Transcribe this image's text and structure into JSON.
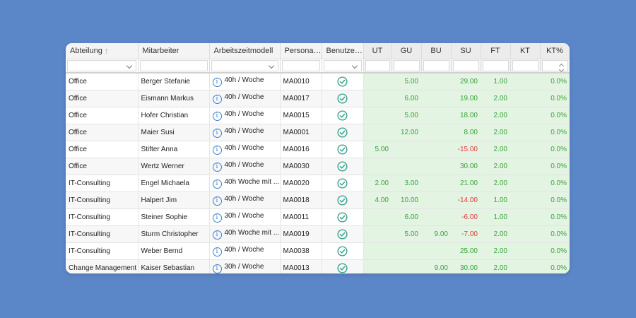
{
  "columns": [
    {
      "label": "Abteilung",
      "sort": "asc"
    },
    {
      "label": "Mitarbeiter"
    },
    {
      "label": "Arbeitszeitmodell"
    },
    {
      "label": "Personal..."
    },
    {
      "label": "Benutzer..."
    },
    {
      "label": "UT"
    },
    {
      "label": "GU"
    },
    {
      "label": "BU"
    },
    {
      "label": "SU"
    },
    {
      "label": "FT"
    },
    {
      "label": "KT"
    },
    {
      "label": "KT%"
    }
  ],
  "colors": {
    "background": "#5b87c9",
    "positive": "#3aa33a",
    "negative": "#e03a3a",
    "numeric_bg": "#e3f4e3",
    "check": "#2e9e8a",
    "info": "#3a7fd0"
  },
  "rows": [
    {
      "abteilung": "Office",
      "mitarbeiter": "Berger Stefanie",
      "modell": "40h / Woche",
      "personal": "MA0010",
      "ut": "",
      "gu": "5.00",
      "bu": "",
      "su": "29.00",
      "ft": "1.00",
      "kt": "",
      "ktp": "0.0%"
    },
    {
      "abteilung": "Office",
      "mitarbeiter": "Eismann Markus",
      "modell": "40h / Woche",
      "personal": "MA0017",
      "ut": "",
      "gu": "6.00",
      "bu": "",
      "su": "19.00",
      "ft": "2.00",
      "kt": "",
      "ktp": "0.0%"
    },
    {
      "abteilung": "Office",
      "mitarbeiter": "Hofer Christian",
      "modell": "40h / Woche",
      "personal": "MA0015",
      "ut": "",
      "gu": "5.00",
      "bu": "",
      "su": "18.00",
      "ft": "2.00",
      "kt": "",
      "ktp": "0.0%"
    },
    {
      "abteilung": "Office",
      "mitarbeiter": "Maier Susi",
      "modell": "40h / Woche",
      "personal": "MA0001",
      "ut": "",
      "gu": "12.00",
      "bu": "",
      "su": "8.00",
      "ft": "2.00",
      "kt": "",
      "ktp": "0.0%"
    },
    {
      "abteilung": "Office",
      "mitarbeiter": "Stifter Anna",
      "modell": "40h / Woche",
      "personal": "MA0016",
      "ut": "5.00",
      "gu": "",
      "bu": "",
      "su": "-15.00",
      "ft": "2.00",
      "kt": "",
      "ktp": "0.0%"
    },
    {
      "abteilung": "Office",
      "mitarbeiter": "Wertz Werner",
      "modell": "40h / Woche",
      "personal": "MA0030",
      "ut": "",
      "gu": "",
      "bu": "",
      "su": "30.00",
      "ft": "2.00",
      "kt": "",
      "ktp": "0.0%"
    },
    {
      "abteilung": "IT-Consulting",
      "mitarbeiter": "Engel Michaela",
      "modell": "40h Woche mit ...",
      "personal": "MA0020",
      "ut": "2.00",
      "gu": "3.00",
      "bu": "",
      "su": "21.00",
      "ft": "2.00",
      "kt": "",
      "ktp": "0.0%"
    },
    {
      "abteilung": "IT-Consulting",
      "mitarbeiter": "Halpert Jim",
      "modell": "40h / Woche",
      "personal": "MA0018",
      "ut": "4.00",
      "gu": "10.00",
      "bu": "",
      "su": "-14.00",
      "ft": "1.00",
      "kt": "",
      "ktp": "0.0%"
    },
    {
      "abteilung": "IT-Consulting",
      "mitarbeiter": "Steiner Sophie",
      "modell": "30h / Woche",
      "personal": "MA0011",
      "ut": "",
      "gu": "6.00",
      "bu": "",
      "su": "-6.00",
      "ft": "1.00",
      "kt": "",
      "ktp": "0.0%"
    },
    {
      "abteilung": "IT-Consulting",
      "mitarbeiter": "Sturm Christopher",
      "modell": "40h Woche mit ...",
      "personal": "MA0019",
      "ut": "",
      "gu": "5.00",
      "bu": "9.00",
      "su": "-7.00",
      "ft": "2.00",
      "kt": "",
      "ktp": "0.0%"
    },
    {
      "abteilung": "IT-Consulting",
      "mitarbeiter": "Weber Bernd",
      "modell": "40h / Woche",
      "personal": "MA0038",
      "ut": "",
      "gu": "",
      "bu": "",
      "su": "25.00",
      "ft": "2.00",
      "kt": "",
      "ktp": "0.0%"
    },
    {
      "abteilung": "Change Management",
      "mitarbeiter": "Kaiser Sebastian",
      "modell": "30h / Woche",
      "personal": "MA0013",
      "ut": "",
      "gu": "",
      "bu": "9.00",
      "su": "30.00",
      "ft": "2.00",
      "kt": "",
      "ktp": "0.0%"
    }
  ]
}
